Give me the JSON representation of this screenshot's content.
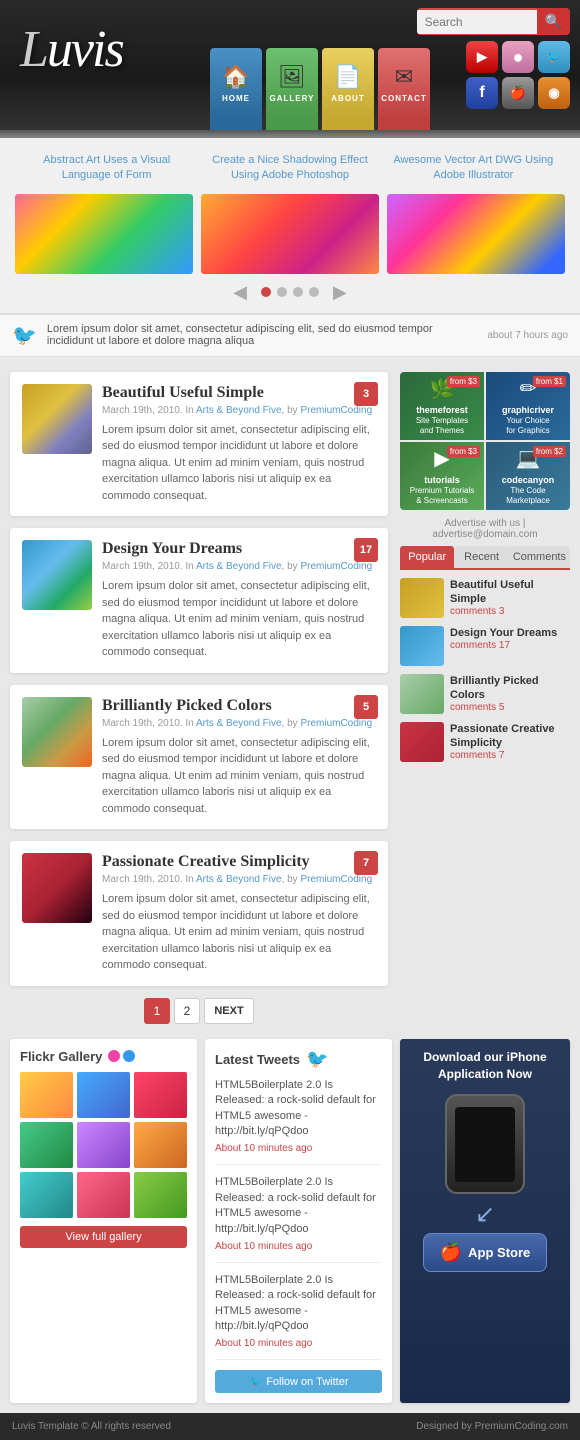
{
  "header": {
    "logo": "luvis",
    "nav": [
      {
        "label": "HOME",
        "icon": "🏠"
      },
      {
        "label": "GALLERY",
        "icon": "🖼"
      },
      {
        "label": "ABOUT",
        "icon": "📄"
      },
      {
        "label": "CONTACT",
        "icon": "✉"
      }
    ],
    "social": [
      {
        "name": "YouTube",
        "class": "si-youtube",
        "icon": "▶"
      },
      {
        "name": "Flickr",
        "class": "si-flickr",
        "icon": "●"
      },
      {
        "name": "Twitter",
        "class": "si-twitter",
        "icon": "🐦"
      },
      {
        "name": "Facebook",
        "class": "si-facebook",
        "icon": "f"
      },
      {
        "name": "Apple",
        "class": "si-apple",
        "icon": "🍎"
      },
      {
        "name": "RSS",
        "class": "si-rss",
        "icon": "◉"
      }
    ],
    "search_placeholder": "Search",
    "search_button": "🔍"
  },
  "slider": {
    "titles": [
      "Abstract Art Uses a Visual Language of Form",
      "Create a Nice Shadowing Effect Using Adobe Photoshop",
      "Awesome Vector Art DWG Using Adobe Illustrator"
    ],
    "dots": 4,
    "active_dot": 1
  },
  "twitter_bar": {
    "text": "Lorem ipsum dolor sit amet, consectetur adipiscing elit, sed do eiusmod tempor incididunt ut labore et dolore magna aliqua",
    "time": "about 7 hours ago"
  },
  "posts": [
    {
      "title": "Beautiful Useful Simple",
      "date": "March 19th, 2010",
      "category": "Arts & Beyond Five",
      "author": "PremiumCoding",
      "excerpt": "Lorem ipsum dolor sit amet, consectetur adipiscing elit, sed do eiusmod tempor incididunt ut labore et dolore magna aliqua. Ut enim ad minim veniam, quis nostrud exercitation ullamco laboris nisi ut aliquip ex ea commodo consequat.",
      "comments": "3",
      "thumb_class": "thumb-1"
    },
    {
      "title": "Design Your Dreams",
      "date": "March 19th, 2010",
      "category": "Arts & Beyond Five",
      "author": "PremiumCoding",
      "excerpt": "Lorem ipsum dolor sit amet, consectetur adipiscing elit, sed do eiusmod tempor incididunt ut labore et dolore magna aliqua. Ut enim ad minim veniam, quis nostrud exercitation ullamco laboris nisi ut aliquip ex ea commodo consequat.",
      "comments": "17",
      "thumb_class": "thumb-2"
    },
    {
      "title": "Brilliantly Picked Colors",
      "date": "March 19th, 2010",
      "category": "Arts & Beyond Five",
      "author": "PremiumCoding",
      "excerpt": "Lorem ipsum dolor sit amet, consectetur adipiscing elit, sed do eiusmod tempor incididunt ut labore et dolore magna aliqua. Ut enim ad minim veniam, quis nostrud exercitation ullamco laboris nisi ut aliquip ex ea commodo consequat.",
      "comments": "5",
      "thumb_class": "thumb-3"
    },
    {
      "title": "Passionate Creative Simplicity",
      "date": "March 19th, 2010",
      "category": "Arts & Beyond Five",
      "author": "PremiumCoding",
      "excerpt": "Lorem ipsum dolor sit amet, consectetur adipiscing elit, sed do eiusmod tempor incididunt ut labore et dolore magna aliqua. Ut enim ad minim veniam, quis nostrud exercitation ullamco laboris nisi ut aliquip ex ea commodo consequat.",
      "comments": "7",
      "thumb_class": "thumb-4"
    }
  ],
  "pagination": {
    "pages": [
      "1",
      "2"
    ],
    "next_label": "NEXT"
  },
  "sidebar": {
    "ads": [
      {
        "label": "themeforest\nSite Templates\nand Themes",
        "class": "ad-themeforest",
        "price": "from $3",
        "icon": "🌿"
      },
      {
        "label": "graphicriver\nYour Choice\nfor Graphics",
        "class": "ad-graphicriver",
        "price": "from $1",
        "icon": "✏"
      },
      {
        "label": "tutorials\nPremium Tutorials\n& Screencasts",
        "class": "ad-tutorials",
        "price": "from $3",
        "icon": "▶"
      },
      {
        "label": "codecanyon\nThe Code\nMarketplace",
        "class": "ad-codecanyon",
        "price": "from $2",
        "icon": "💻"
      }
    ],
    "advertise": "Advertise with us | advertise@domain.com",
    "tabs": [
      "Popular",
      "Recent",
      "Comments"
    ],
    "active_tab": 0,
    "sidebar_posts": [
      {
        "title": "Beautiful Useful Simple",
        "comments": "comments 3",
        "thumb_class": "st-1"
      },
      {
        "title": "Design Your Dreams",
        "comments": "comments 17",
        "thumb_class": "st-2"
      },
      {
        "title": "Brilliantly Picked Colors",
        "comments": "comments 5",
        "thumb_class": "st-3"
      },
      {
        "title": "Passionate Creative Simplicity",
        "comments": "comments 7",
        "thumb_class": "st-4"
      }
    ]
  },
  "flickr": {
    "title": "Flickr Gallery",
    "view_label": "View full gallery",
    "images": [
      "fi-1",
      "fi-2",
      "fi-3",
      "fi-4",
      "fi-5",
      "fi-6",
      "fi-7",
      "fi-8",
      "fi-9"
    ]
  },
  "tweets": {
    "title": "Latest Tweets",
    "items": [
      {
        "text": "HTML5Boilerplate 2.0 Is Released: a rock-solid default for HTML5 awesome - http://bit.ly/qPQdoo",
        "time": "About 10 minutes ago"
      },
      {
        "text": "HTML5Boilerplate 2.0 Is Released: a rock-solid default for HTML5 awesome - http://bit.ly/qPQdoo",
        "time": "About 10 minutes ago"
      },
      {
        "text": "HTML5Boilerplate 2.0 Is Released: a rock-solid default for HTML5 awesome - http://bit.ly/qPQdoo",
        "time": "About 10 minutes ago"
      }
    ],
    "follow_label": "Follow on Twitter"
  },
  "appstore": {
    "title": "Download our iPhone Application Now",
    "button_label": "App Store"
  },
  "footer": {
    "left": "Luvis Template © All rights reserved",
    "right": "Designed by PremiumCoding.com"
  }
}
